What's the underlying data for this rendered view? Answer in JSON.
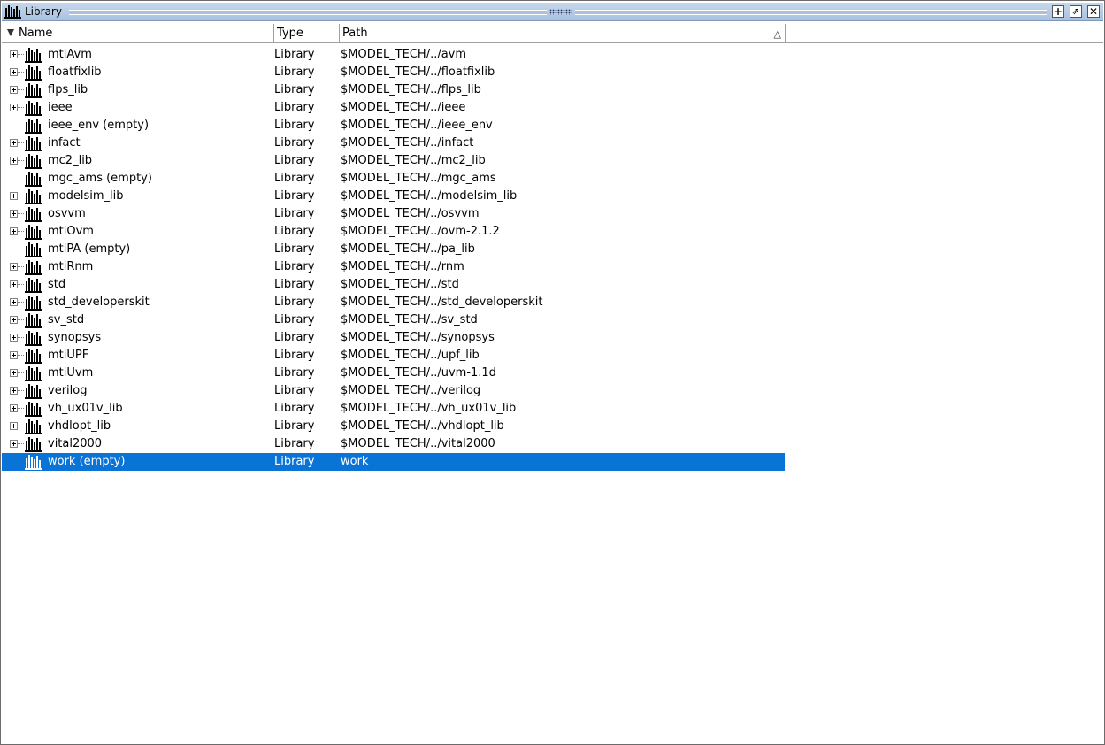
{
  "window": {
    "title": "Library",
    "buttons": {
      "plus": "+",
      "undock": "⇗",
      "close": "✕"
    }
  },
  "columns": {
    "name": "Name",
    "type": "Type",
    "path": "Path"
  },
  "rows": [
    {
      "name": "mtiAvm",
      "type": "Library",
      "path": "$MODEL_TECH/../avm",
      "expandable": true
    },
    {
      "name": "floatfixlib",
      "type": "Library",
      "path": "$MODEL_TECH/../floatfixlib",
      "expandable": true
    },
    {
      "name": "flps_lib",
      "type": "Library",
      "path": "$MODEL_TECH/../flps_lib",
      "expandable": true
    },
    {
      "name": "ieee",
      "type": "Library",
      "path": "$MODEL_TECH/../ieee",
      "expandable": true
    },
    {
      "name": "ieee_env  (empty)",
      "type": "Library",
      "path": "$MODEL_TECH/../ieee_env",
      "expandable": false
    },
    {
      "name": "infact",
      "type": "Library",
      "path": "$MODEL_TECH/../infact",
      "expandable": true
    },
    {
      "name": "mc2_lib",
      "type": "Library",
      "path": "$MODEL_TECH/../mc2_lib",
      "expandable": true
    },
    {
      "name": "mgc_ams  (empty)",
      "type": "Library",
      "path": "$MODEL_TECH/../mgc_ams",
      "expandable": false
    },
    {
      "name": "modelsim_lib",
      "type": "Library",
      "path": "$MODEL_TECH/../modelsim_lib",
      "expandable": true
    },
    {
      "name": "osvvm",
      "type": "Library",
      "path": "$MODEL_TECH/../osvvm",
      "expandable": true
    },
    {
      "name": "mtiOvm",
      "type": "Library",
      "path": "$MODEL_TECH/../ovm-2.1.2",
      "expandable": true
    },
    {
      "name": "mtiPA  (empty)",
      "type": "Library",
      "path": "$MODEL_TECH/../pa_lib",
      "expandable": false
    },
    {
      "name": "mtiRnm",
      "type": "Library",
      "path": "$MODEL_TECH/../rnm",
      "expandable": true
    },
    {
      "name": "std",
      "type": "Library",
      "path": "$MODEL_TECH/../std",
      "expandable": true
    },
    {
      "name": "std_developerskit",
      "type": "Library",
      "path": "$MODEL_TECH/../std_developerskit",
      "expandable": true
    },
    {
      "name": "sv_std",
      "type": "Library",
      "path": "$MODEL_TECH/../sv_std",
      "expandable": true
    },
    {
      "name": "synopsys",
      "type": "Library",
      "path": "$MODEL_TECH/../synopsys",
      "expandable": true
    },
    {
      "name": "mtiUPF",
      "type": "Library",
      "path": "$MODEL_TECH/../upf_lib",
      "expandable": true
    },
    {
      "name": "mtiUvm",
      "type": "Library",
      "path": "$MODEL_TECH/../uvm-1.1d",
      "expandable": true
    },
    {
      "name": "verilog",
      "type": "Library",
      "path": "$MODEL_TECH/../verilog",
      "expandable": true
    },
    {
      "name": "vh_ux01v_lib",
      "type": "Library",
      "path": "$MODEL_TECH/../vh_ux01v_lib",
      "expandable": true
    },
    {
      "name": "vhdlopt_lib",
      "type": "Library",
      "path": "$MODEL_TECH/../vhdlopt_lib",
      "expandable": true
    },
    {
      "name": "vital2000",
      "type": "Library",
      "path": "$MODEL_TECH/../vital2000",
      "expandable": true
    },
    {
      "name": "work  (empty)",
      "type": "Library",
      "path": "work",
      "expandable": false,
      "selected": true
    }
  ],
  "colors": {
    "selection": "#0a74d6",
    "titlebar": "#a9c1df"
  }
}
